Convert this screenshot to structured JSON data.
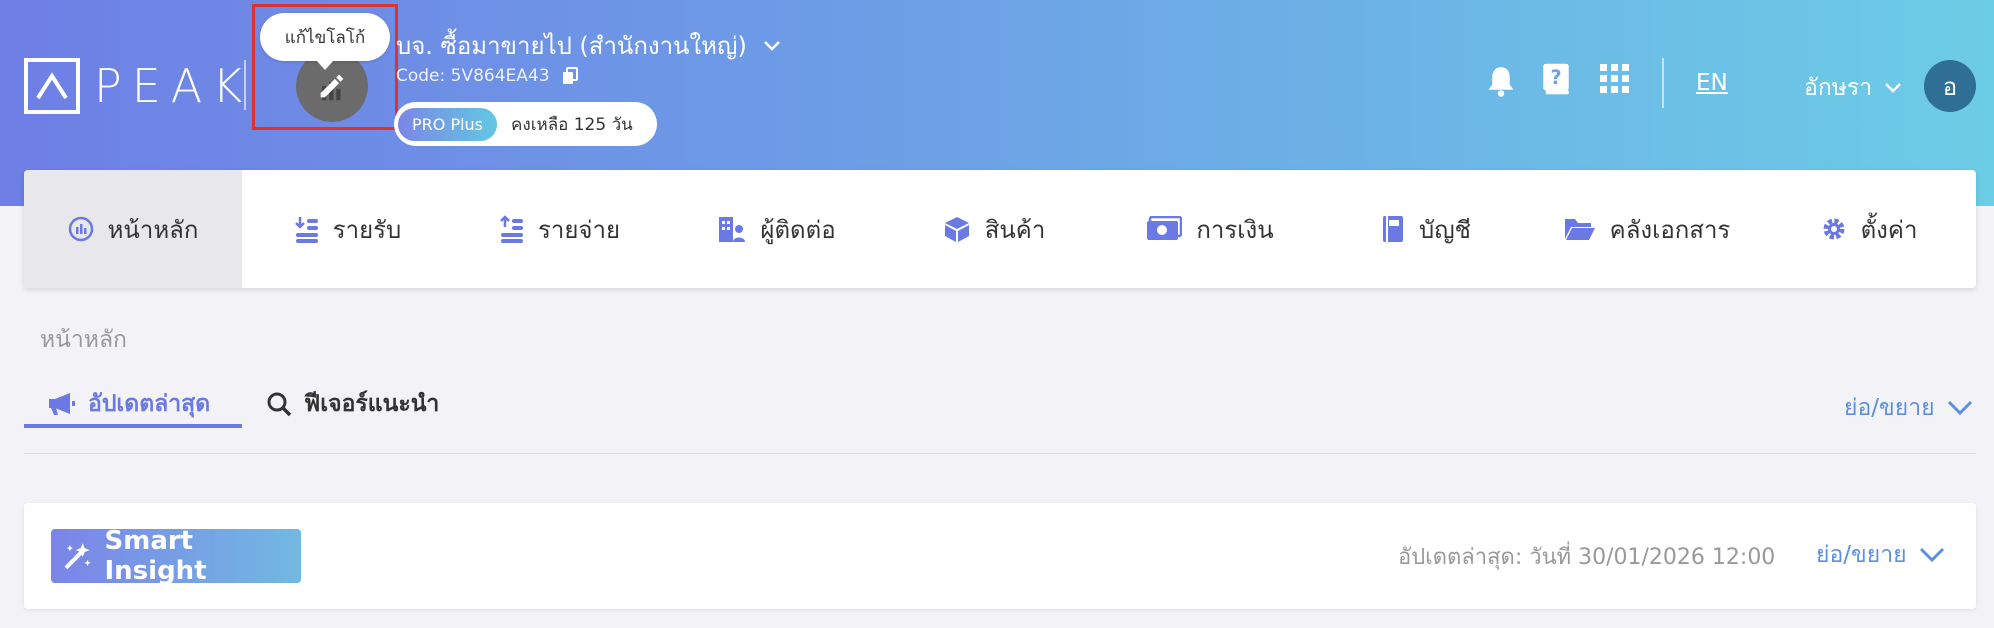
{
  "brand": {
    "logo_text": "PEAK"
  },
  "company": {
    "tooltip": "แก้ไขโลโก้",
    "name": "บจ. ซื้อมาขายไป (สำนักงานใหญ่)",
    "code": "Code: 5V864EA43",
    "plan": "PRO Plus",
    "remaining": "คงเหลือ 125 วัน"
  },
  "topbar": {
    "icons": [
      "bell-icon",
      "help-book-icon",
      "apps-grid-icon"
    ],
    "language": "EN",
    "user_name": "อักษรา",
    "avatar_initial": "อ"
  },
  "nav": {
    "items": [
      {
        "label": "หน้าหลัก",
        "icon": "dashboard-icon",
        "active": true
      },
      {
        "label": "รายรับ",
        "icon": "income-icon"
      },
      {
        "label": "รายจ่าย",
        "icon": "expense-icon"
      },
      {
        "label": "ผู้ติดต่อ",
        "icon": "contacts-icon"
      },
      {
        "label": "สินค้า",
        "icon": "product-box-icon"
      },
      {
        "label": "การเงิน",
        "icon": "money-icon"
      },
      {
        "label": "บัญชี",
        "icon": "ledger-book-icon"
      },
      {
        "label": "คลังเอกสาร",
        "icon": "folder-icon"
      },
      {
        "label": "ตั้งค่า",
        "icon": "gear-icon"
      }
    ]
  },
  "breadcrumb": "หน้าหลัก",
  "tabs": [
    {
      "label": "อัปเดตล่าสุด",
      "icon": "megaphone-icon",
      "active": true
    },
    {
      "label": "ฟีเจอร์แนะนำ",
      "icon": "search-icon"
    }
  ],
  "collapse_label": "ย่อ/ขยาย",
  "card": {
    "button": "Smart Insight",
    "updated": "อัปเดตล่าสุด: วันที่ 30/01/2026 12:00",
    "collapse_label": "ย่อ/ขยาย"
  },
  "colors": {
    "accent": "#6b79e4",
    "link": "#5b8fe0",
    "header_start": "#6e7fe6",
    "header_end": "#6ccde6",
    "highlight": "#e03131"
  }
}
